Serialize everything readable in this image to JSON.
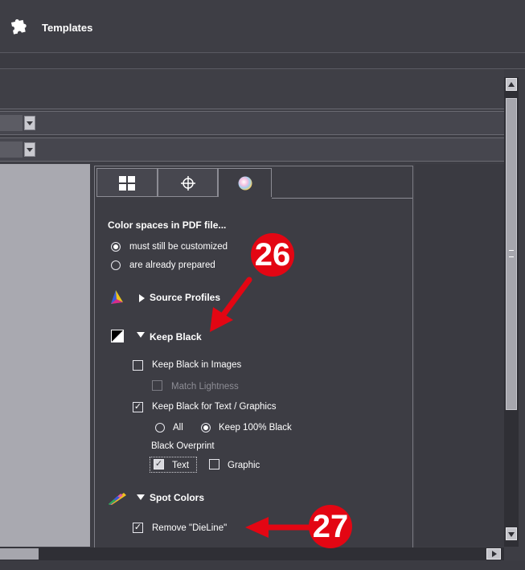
{
  "window": {
    "title": "Templates",
    "icon": "puzzle-piece-icon"
  },
  "tabs": [
    {
      "name": "layout-grid-icon"
    },
    {
      "name": "crosshair-icon"
    },
    {
      "name": "color-wheel-icon"
    }
  ],
  "color_spaces": {
    "heading": "Color spaces in PDF file...",
    "options": [
      {
        "label": "must still be customized",
        "selected": true
      },
      {
        "label": "are already prepared",
        "selected": false
      }
    ]
  },
  "sections": {
    "source_profiles": {
      "label": "Source Profiles",
      "icon": "rgb-triangle-icon",
      "expanded": false
    },
    "keep_black": {
      "label": "Keep Black",
      "icon": "black-white-diagonal-icon",
      "expanded": true
    },
    "spot_colors": {
      "label": "Spot Colors",
      "icon": "color-swatch-icon",
      "expanded": true
    }
  },
  "keep_black": {
    "in_images": {
      "label": "Keep Black in Images",
      "checked": false
    },
    "match_lightness": {
      "label": "Match Lightness",
      "checked": false,
      "enabled": false
    },
    "for_text": {
      "label": "Keep Black for Text / Graphics",
      "checked": true
    },
    "mode_all": {
      "label": "All",
      "selected": false
    },
    "mode_100": {
      "label": "Keep 100% Black",
      "selected": true
    },
    "overprint_label": "Black Overprint",
    "overprint_text": {
      "label": "Text",
      "checked": true
    },
    "overprint_graphic": {
      "label": "Graphic",
      "checked": false
    }
  },
  "spot_colors": {
    "remove_dieline": {
      "label": "Remove \"DieLine\"",
      "checked": true
    }
  },
  "callouts": {
    "a": "26",
    "b": "27"
  },
  "colors": {
    "callout": "#e30613",
    "background": "#3d3d44"
  }
}
